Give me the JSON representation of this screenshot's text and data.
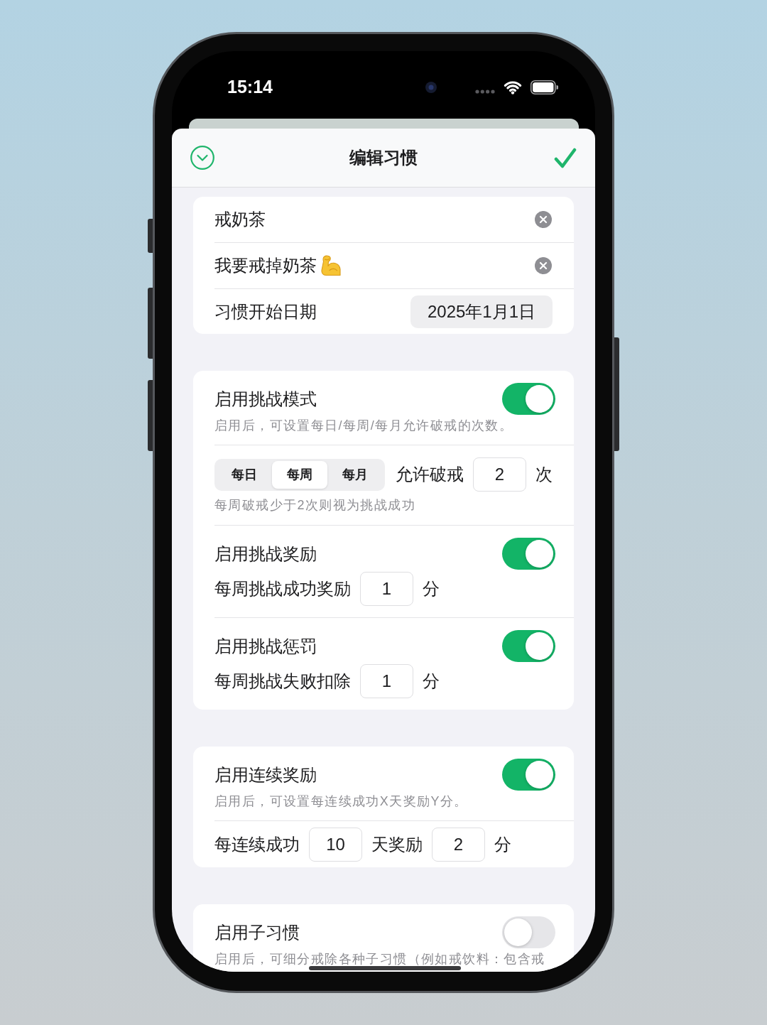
{
  "status_bar": {
    "time": "15:14"
  },
  "header": {
    "title": "编辑习惯"
  },
  "sections": [
    {
      "rows": [
        {
          "kind": "text_field",
          "value": "戒奶茶",
          "emoji": false
        },
        {
          "kind": "text_field",
          "value": "我要戒掉奶茶",
          "emoji": true
        },
        {
          "kind": "date",
          "label": "习惯开始日期",
          "value": "2025年1月1日"
        }
      ]
    },
    {
      "rows": [
        {
          "kind": "toggle",
          "label": "启用挑战模式",
          "on": true,
          "description": "启用后，可设置每日/每周/每月允许破戒的次数。"
        },
        {
          "kind": "period",
          "segments": [
            {
              "label": "每日",
              "selected": false
            },
            {
              "label": "每周",
              "selected": true
            },
            {
              "label": "每月",
              "selected": false
            }
          ],
          "parts": [
            {
              "kind": "text",
              "text": "允许破戒"
            },
            {
              "kind": "number",
              "value": "2"
            },
            {
              "kind": "text",
              "text": "次"
            }
          ],
          "hint": "每周破戒少于2次则视为挑战成功"
        },
        {
          "kind": "toggle",
          "label": "启用挑战奖励",
          "on": true,
          "parts": [
            {
              "kind": "text",
              "text": "每周挑战成功奖励"
            },
            {
              "kind": "number",
              "value": "1"
            },
            {
              "kind": "text",
              "text": "分"
            }
          ]
        },
        {
          "kind": "toggle",
          "label": "启用挑战惩罚",
          "on": true,
          "parts": [
            {
              "kind": "text",
              "text": "每周挑战失败扣除"
            },
            {
              "kind": "number",
              "value": "1"
            },
            {
              "kind": "text",
              "text": "分"
            }
          ]
        }
      ]
    },
    {
      "rows": [
        {
          "kind": "toggle",
          "label": "启用连续奖励",
          "on": true,
          "description": "启用后，可设置每连续成功X天奖励Y分。"
        },
        {
          "kind": "inputs",
          "parts": [
            {
              "kind": "text",
              "text": "每连续成功"
            },
            {
              "kind": "number",
              "value": "10"
            },
            {
              "kind": "text",
              "text": "天奖励"
            },
            {
              "kind": "number",
              "value": "2"
            },
            {
              "kind": "text",
              "text": "分"
            }
          ]
        }
      ]
    },
    {
      "rows": [
        {
          "kind": "toggle",
          "label": "启用子习惯",
          "on": false,
          "description": "启用后，可细分戒除各种子习惯（例如戒饮料：包含戒"
        }
      ]
    }
  ]
}
